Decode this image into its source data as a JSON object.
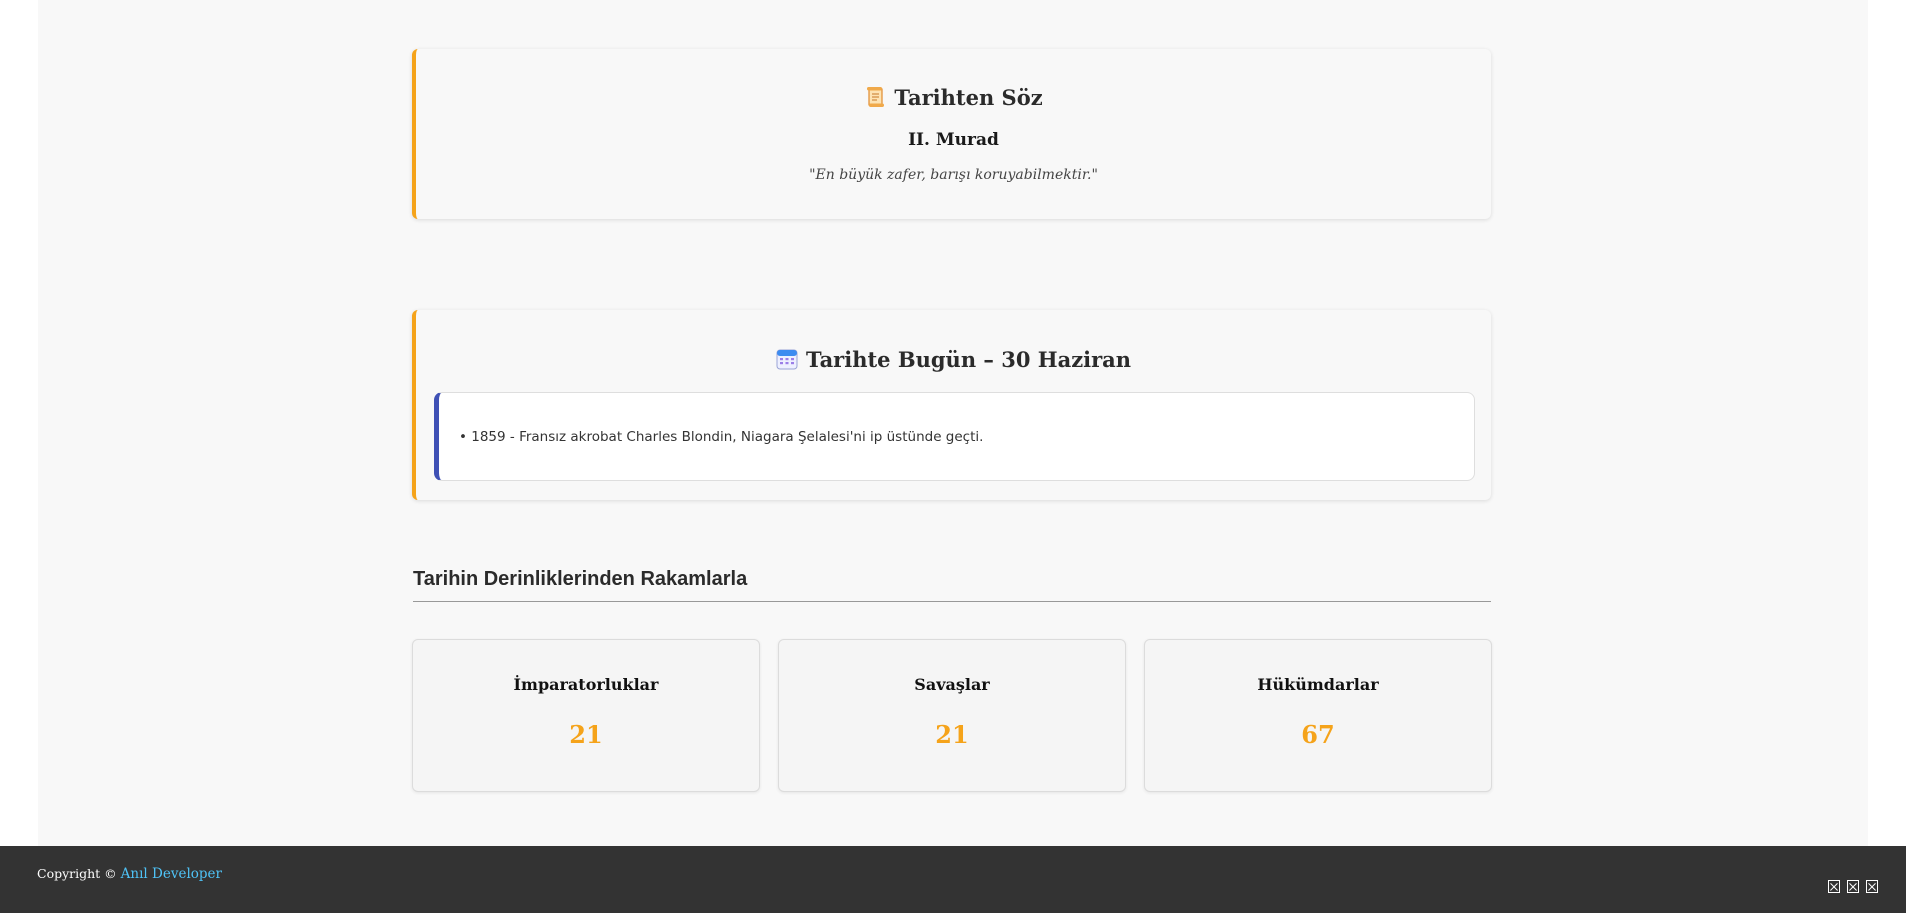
{
  "quote": {
    "icon": "scroll-icon",
    "title": "Tarihten Söz",
    "author": "II. Murad",
    "text": "\"En büyük zafer, barışı koruyabilmektir.\""
  },
  "today": {
    "icon": "calendar-icon",
    "title": "Tarihte Bugün – 30 Haziran",
    "events": [
      "• 1859 - Fransız akrobat Charles Blondin, Niagara Şelalesi'ni ip üstünde geçti."
    ]
  },
  "stats": {
    "title": "Tarihin Derinliklerinden Rakamlarla",
    "items": [
      {
        "label": "İmparatorluklar",
        "value": "21"
      },
      {
        "label": "Savaşlar",
        "value": "21"
      },
      {
        "label": "Hükümdarlar",
        "value": "67"
      }
    ]
  },
  "footer": {
    "copyright": "Copyright ©",
    "developer": "Anıl Developer",
    "icons": [
      "social-icon-1",
      "social-icon-2",
      "social-icon-3"
    ]
  },
  "colors": {
    "accent": "#f5a31a",
    "event_border": "#3f51b5",
    "footer_bg": "#333333",
    "link": "#4fc3f7"
  }
}
